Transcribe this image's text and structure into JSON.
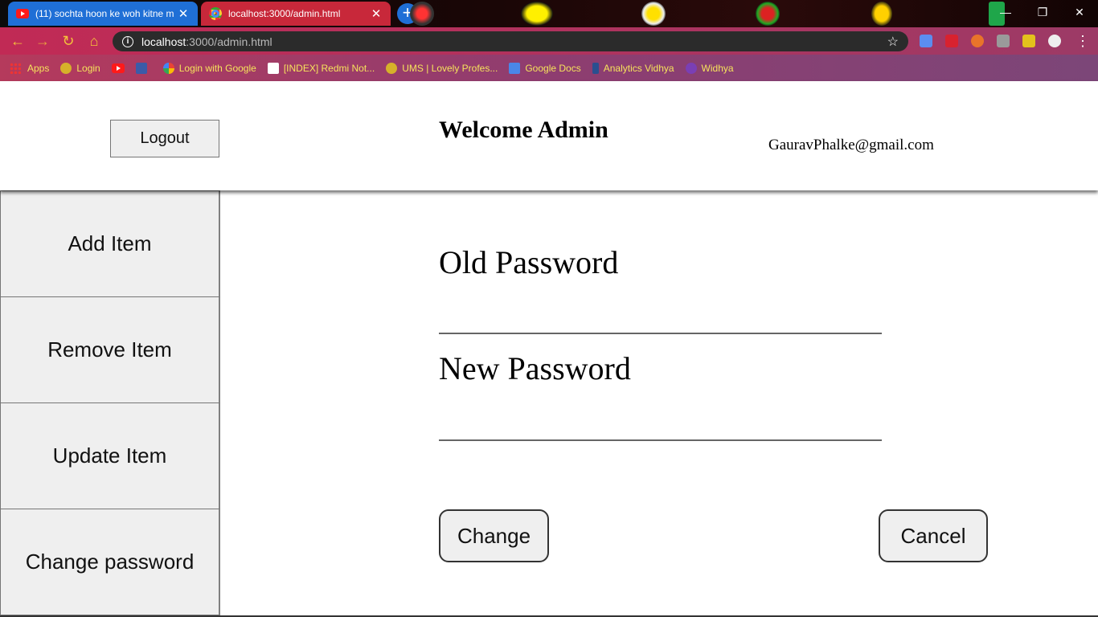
{
  "browser": {
    "tabs": [
      {
        "title": "(11) sochta hoon ke woh kitne m",
        "active": false
      },
      {
        "title": "localhost:3000/admin.html",
        "active": true
      }
    ],
    "close_glyph": "✕",
    "new_tab_glyph": "+",
    "window_controls": {
      "minimize": "—",
      "restore": "❐",
      "close": "✕"
    },
    "url": {
      "host": "localhost",
      "path": ":3000/admin.html"
    },
    "nav_icons": {
      "back": "←",
      "forward": "→",
      "reload": "↻",
      "home": "⌂"
    },
    "star_glyph": "☆",
    "menu_glyph": "⋮",
    "bookmarks": [
      {
        "label": "Apps",
        "icon": "apps-grid-icon"
      },
      {
        "label": "Login",
        "icon": "globe-icon"
      },
      {
        "label": "",
        "icon": "youtube-icon"
      },
      {
        "label": "",
        "icon": "facebook-icon"
      },
      {
        "label": "Login with Google",
        "icon": "google-icon"
      },
      {
        "label": "[INDEX] Redmi Not...",
        "icon": "xda-icon"
      },
      {
        "label": "UMS | Lovely Profes...",
        "icon": "globe-icon"
      },
      {
        "label": "Google Docs",
        "icon": "docs-icon"
      },
      {
        "label": "Analytics Vidhya",
        "icon": "analytics-icon"
      },
      {
        "label": "Widhya",
        "icon": "widhya-icon"
      }
    ]
  },
  "header": {
    "logout_label": "Logout",
    "welcome_text": "Welcome Admin",
    "email": "GauravPhalke@gmail.com"
  },
  "sidebar": {
    "items": [
      {
        "label": "Add Item"
      },
      {
        "label": "Remove Item"
      },
      {
        "label": "Update Item"
      },
      {
        "label": "Change password"
      }
    ]
  },
  "form": {
    "old_password_label": "Old Password",
    "old_password_value": "",
    "new_password_label": "New Password",
    "new_password_value": "",
    "change_label": "Change",
    "cancel_label": "Cancel"
  },
  "colors": {
    "button_bg": "#efefef",
    "button_border": "#767676",
    "bookmark_text": "#f6e35c"
  }
}
